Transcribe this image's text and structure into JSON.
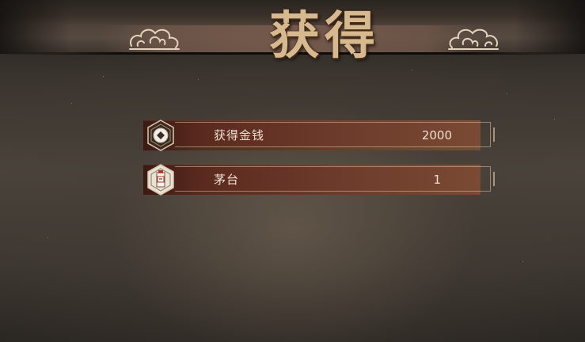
{
  "header": {
    "title": "获得"
  },
  "rewards": [
    {
      "icon": "coin-icon",
      "label": "获得金钱",
      "amount": "2000"
    },
    {
      "icon": "liquor-bottle-icon",
      "label": "茅台",
      "amount": "1"
    }
  ],
  "colors": {
    "title_gold": "#d6b98e",
    "row_maroon": "#5b2a1f",
    "text_cream": "#ece0cc"
  }
}
